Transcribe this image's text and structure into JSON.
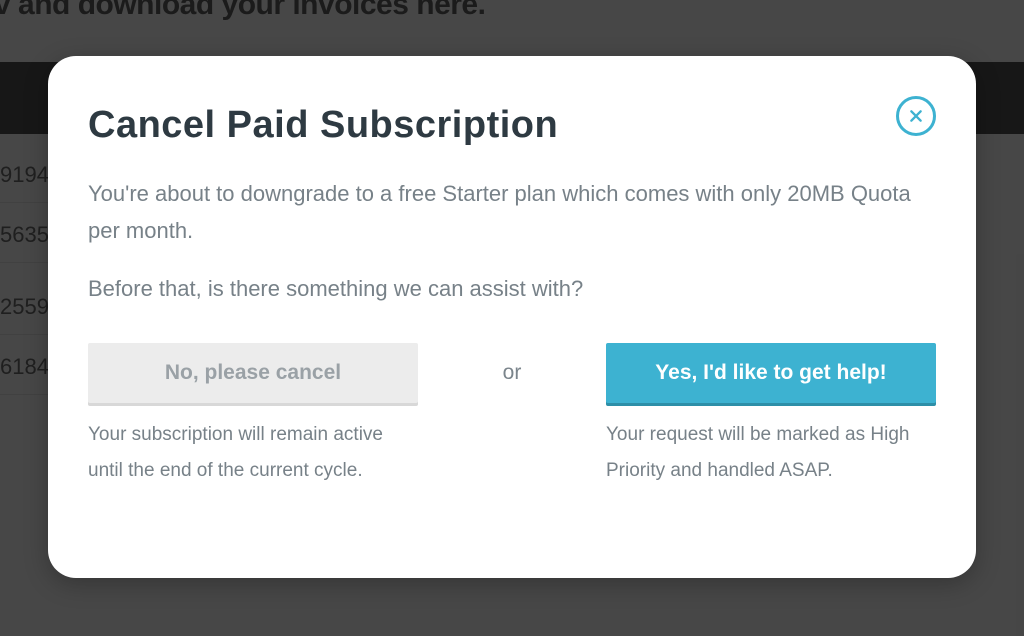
{
  "background": {
    "header_fragment": "v and download your invoices here.",
    "rows": [
      "9194",
      "5635",
      "2559",
      "6184"
    ]
  },
  "modal": {
    "title": "Cancel Paid Subscription",
    "body_line1": "You're about to downgrade to a free Starter plan which comes with only 20MB Quota per month.",
    "body_line2": "Before that, is there something we can assist with?",
    "separator": "or",
    "cancel": {
      "label": "No, please cancel",
      "caption": "Your subscription will remain active until the end of the current cycle."
    },
    "help": {
      "label": "Yes, I'd like to get help!",
      "caption": "Your request will be marked as High Priority and handled ASAP."
    }
  }
}
